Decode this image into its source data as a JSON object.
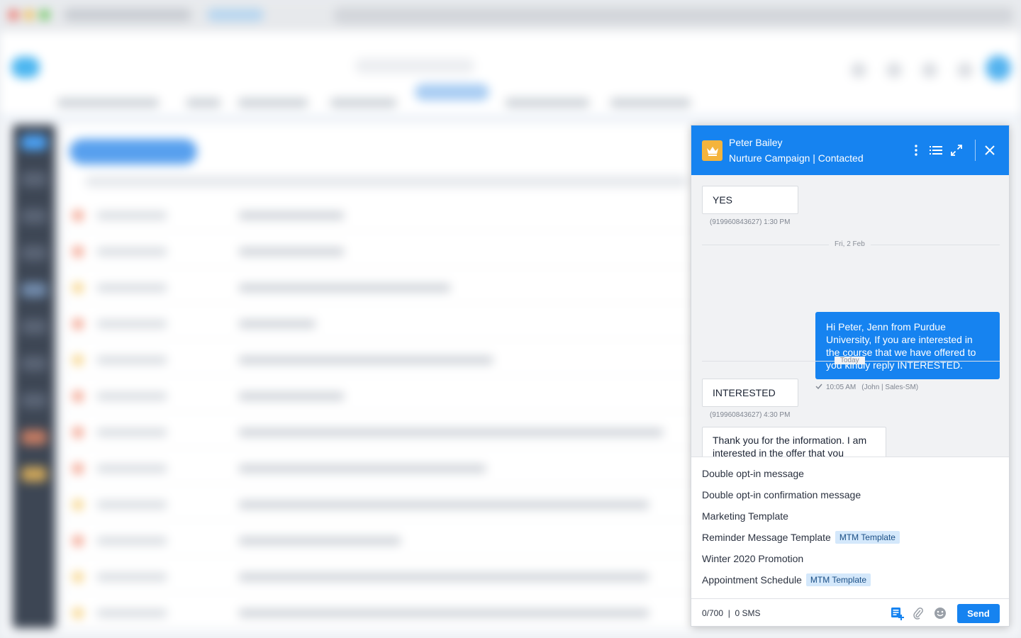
{
  "colors": {
    "accent": "#1683f0",
    "crown_bg": "#f4b43c",
    "badge_bg": "#d4e8fb"
  },
  "chat": {
    "contact_name": "Peter Bailey",
    "contact_subtitle": "Nurture Campaign | Contacted",
    "icons": [
      "crown-icon",
      "more-vertical-icon",
      "list-icon",
      "expand-icon",
      "close-icon"
    ],
    "messages": {
      "msg1_text": "YES",
      "msg1_meta": "(919960843627)  1:30 PM",
      "divider1": "Fri, 2 Feb",
      "out_text": "Hi Peter, Jenn from Purdue University, If you are interested in the course that we have offered to you kindly reply INTERESTED.",
      "out_meta_time": "10:05 AM",
      "out_meta_sender": "(John | Sales-SM)",
      "divider2": "Today",
      "msg2_text": "INTERESTED",
      "msg2_meta": "(919960843627)  4:30 PM",
      "msg3_text": "Thank you for the information. I am interested in the offer that you"
    },
    "templates": [
      {
        "name": "Double opt-in message",
        "badge": ""
      },
      {
        "name": "Double opt-in confirmation message",
        "badge": ""
      },
      {
        "name": "Marketing Template",
        "badge": ""
      },
      {
        "name": "Reminder Message Template",
        "badge": "MTM Template"
      },
      {
        "name": "Winter 2020 Promotion",
        "badge": ""
      },
      {
        "name": "Appointment Schedule",
        "badge": "MTM Template"
      }
    ],
    "footer": {
      "counter": "0/700  |  0 SMS",
      "send_label": "Send",
      "icons": [
        "template-add-icon",
        "attachment-icon",
        "emoji-icon"
      ]
    }
  }
}
